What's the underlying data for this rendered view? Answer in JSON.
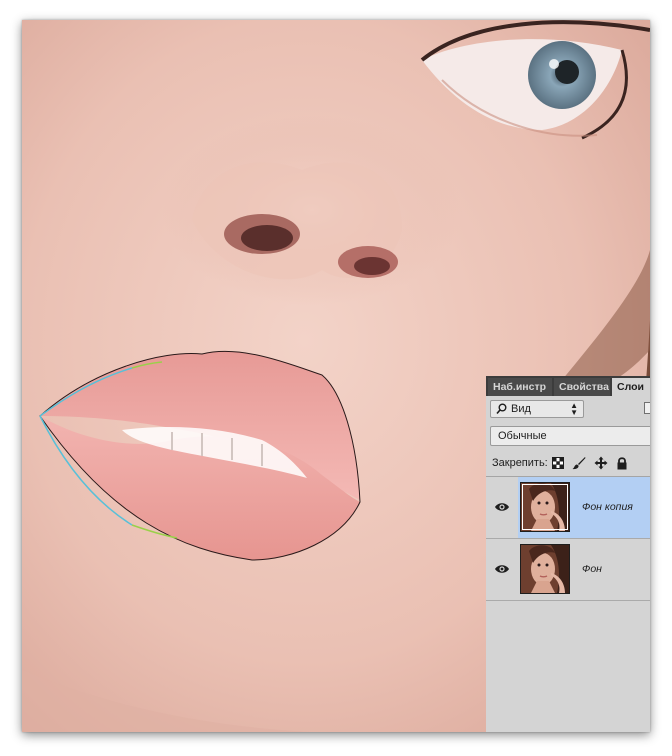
{
  "layers_panel": {
    "tabs": [
      {
        "label": "Наб.инстр"
      },
      {
        "label": "Свойства"
      },
      {
        "label": "Слои"
      }
    ],
    "filter": {
      "label": "Вид"
    },
    "blend_mode": "Обычные",
    "lock_label": "Закрепить:",
    "layers": [
      {
        "name": "Фон копия",
        "selected": true,
        "visible": true
      },
      {
        "name": "Фон",
        "selected": false,
        "visible": true
      }
    ]
  },
  "colors": {
    "selection_highlight": "#b3cff3",
    "panel_bg": "#d4d4d4",
    "tab_bar": "#3c3c3c"
  },
  "icons": [
    "search-icon",
    "updown-arrows-icon",
    "lock-transparent-icon",
    "lock-brush-icon",
    "lock-position-icon",
    "lock-all-icon",
    "eye-icon"
  ]
}
